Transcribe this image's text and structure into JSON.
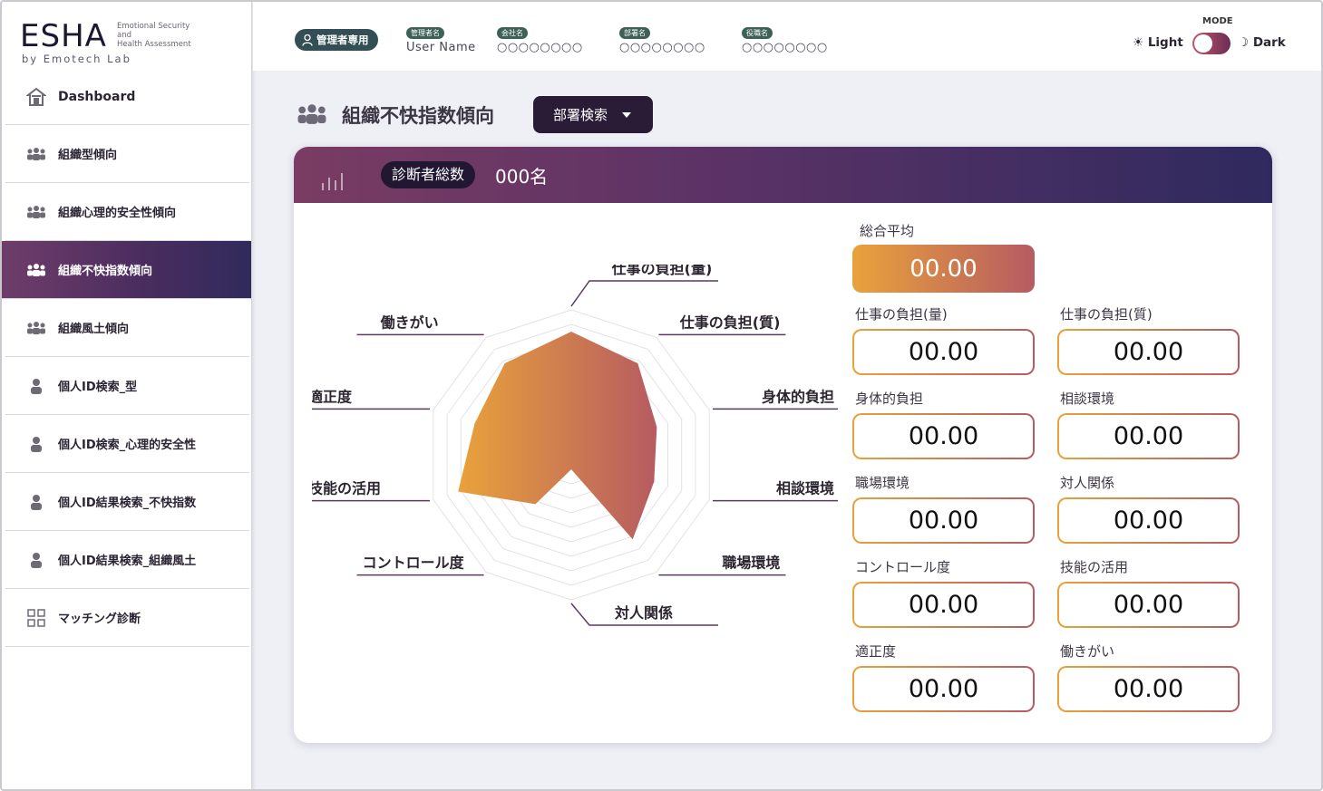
{
  "logo": {
    "main": "ESHA",
    "sub1": "Emotional Security",
    "sub2": "and",
    "sub3": "Health Assessment",
    "by": "by Emotech Lab"
  },
  "sidebar": {
    "items": [
      {
        "label": "Dashboard",
        "icon": "home-icon"
      },
      {
        "label": "組織型傾向",
        "icon": "group-icon"
      },
      {
        "label": "組織心理的安全性傾向",
        "icon": "group-icon"
      },
      {
        "label": "組織不快指数傾向",
        "icon": "group-icon",
        "active": true
      },
      {
        "label": "組織風土傾向",
        "icon": "group-icon"
      },
      {
        "label": "個人ID検索_型",
        "icon": "person-icon"
      },
      {
        "label": "個人ID検索_心理的安全性",
        "icon": "person-icon"
      },
      {
        "label": "個人ID結果検索_不快指数",
        "icon": "person-icon"
      },
      {
        "label": "個人ID結果検索_組織風土",
        "icon": "person-icon"
      },
      {
        "label": "マッチング診断",
        "icon": "grid-icon"
      }
    ]
  },
  "header": {
    "admin_badge": "管理者専用",
    "manager_tag": "管理者名",
    "manager_value": "User Name",
    "company_tag": "会社名",
    "company_value": "○○○○○○○○",
    "dept_tag": "部署名",
    "dept_value": "○○○○○○○○",
    "role_tag": "役職名",
    "role_value": "○○○○○○○○",
    "mode_label": "MODE",
    "light_label": "Light",
    "dark_label": "Dark"
  },
  "page": {
    "title": "組織不快指数傾向",
    "dept_search_label": "部署検索"
  },
  "card": {
    "total_label": "診断者総数",
    "total_value": "000名",
    "overall_label": "総合平均",
    "overall_value": "00.00",
    "scores": [
      {
        "label": "仕事の負担(量)",
        "value": "00.00"
      },
      {
        "label": "仕事の負担(質)",
        "value": "00.00"
      },
      {
        "label": "身体的負担",
        "value": "00.00"
      },
      {
        "label": "相談環境",
        "value": "00.00"
      },
      {
        "label": "職場環境",
        "value": "00.00"
      },
      {
        "label": "対人関係",
        "value": "00.00"
      },
      {
        "label": "コントロール度",
        "value": "00.00"
      },
      {
        "label": "技能の活用",
        "value": "00.00"
      },
      {
        "label": "適正度",
        "value": "00.00"
      },
      {
        "label": "働きがい",
        "value": "00.00"
      }
    ]
  },
  "chart_data": {
    "type": "radar",
    "categories": [
      "仕事の負担(量)",
      "仕事の負担(質)",
      "身体的負担",
      "相談環境",
      "職場環境",
      "対人関係",
      "コントロール度",
      "技能の活用",
      "適正度",
      "働きがい"
    ],
    "values": [
      0.85,
      0.78,
      0.62,
      0.6,
      0.72,
      0.1,
      0.42,
      0.82,
      0.7,
      0.78
    ],
    "fill_colors": [
      "#e9a23b",
      "#b65b62"
    ]
  }
}
